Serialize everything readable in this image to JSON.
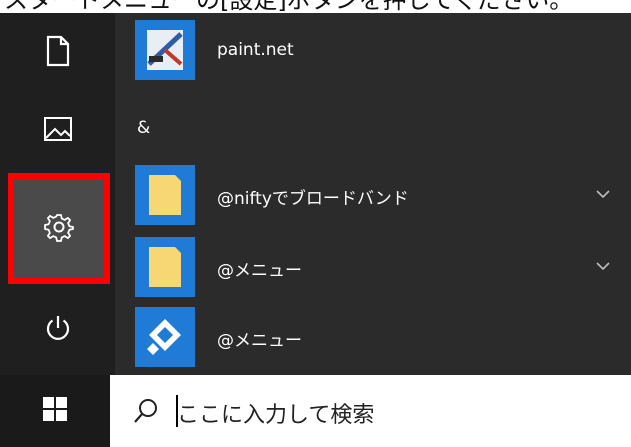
{
  "caption": {
    "text": "スタートメニューの[設定]ボタンを押してください。"
  },
  "rail": {
    "items": [
      {
        "icon": "document-icon"
      },
      {
        "icon": "pictures-icon"
      },
      {
        "icon": "gear-icon",
        "selected": true
      },
      {
        "icon": "power-icon"
      }
    ]
  },
  "apps": {
    "group_letter": "&",
    "items": [
      {
        "label": "paint.net",
        "icon": "paintnet-icon"
      },
      {
        "label": "@niftyでブロードバンド",
        "icon": "folder-icon",
        "expandable": true
      },
      {
        "label": "@メニュー",
        "icon": "folder-icon",
        "expandable": true
      },
      {
        "label": "@メニュー",
        "icon": "atmenu-app-icon",
        "expandable": false
      }
    ]
  },
  "taskbar": {
    "windows_icon": "windows-logo-icon",
    "search": {
      "icon": "search-icon",
      "placeholder": "ここに入力して検索"
    }
  },
  "colors": {
    "accent": "#1f7bd6",
    "highlight_border": "#ff0000",
    "start_bg": "#2b2b2b",
    "rail_bg": "#1f1f1f",
    "taskbar_bg": "#1a1a1a",
    "folder": "#f7d774"
  }
}
